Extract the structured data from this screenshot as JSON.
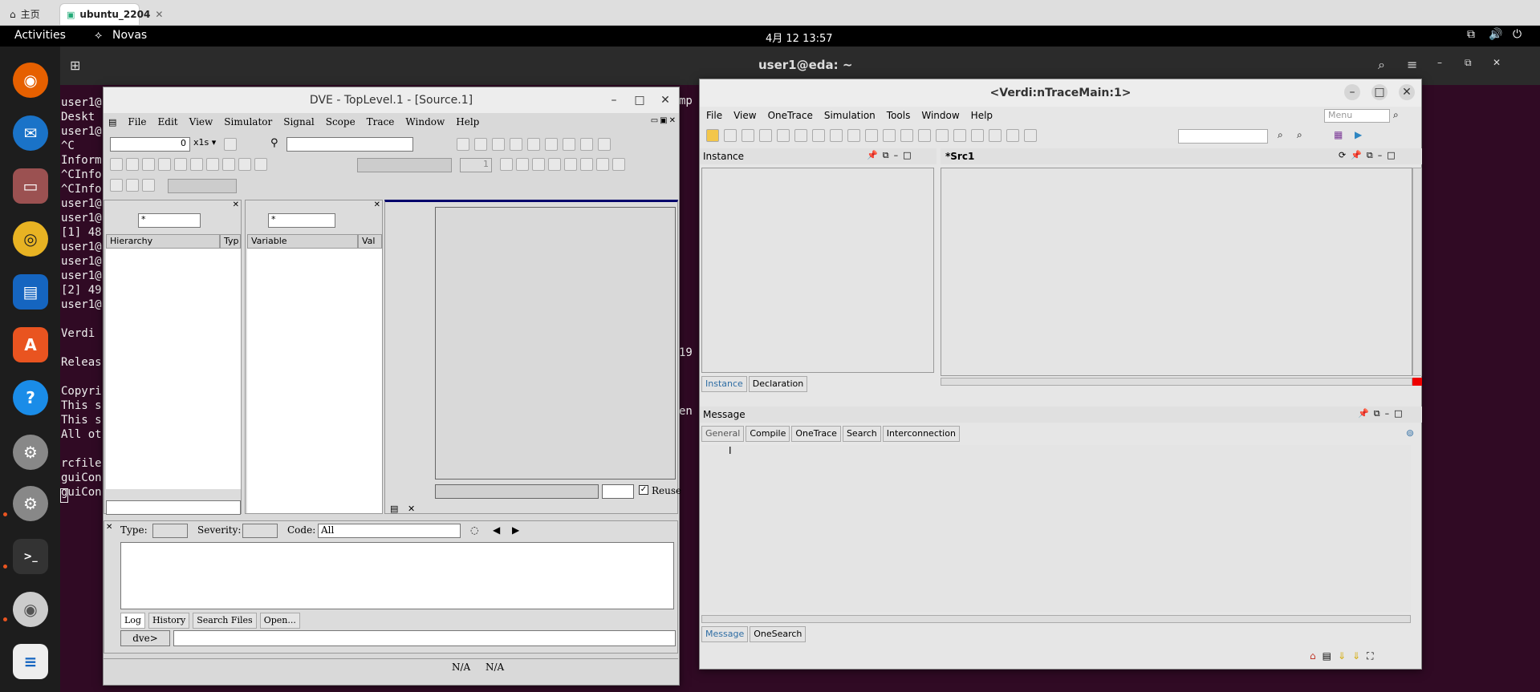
{
  "browser": {
    "tabs": [
      {
        "label": "主页",
        "icon": "home-icon"
      },
      {
        "label": "ubuntu_2204",
        "icon": "vm-icon"
      }
    ]
  },
  "topbar": {
    "activities": "Activities",
    "app_menu": "Novas",
    "clock": "4月 12  13:57"
  },
  "terminal": {
    "title": "user1@eda: ~",
    "lines": [
      "user1@",
      "Deskt",
      "user1@",
      "^C",
      "Inform",
      "^CInfo",
      "^CInfo",
      "user1@",
      "user1@",
      "[1] 48",
      "user1@",
      "user1@",
      "user1@",
      "[2] 49",
      "user1@",
      "",
      "Verdi",
      "",
      "Releas",
      "",
      "Copyri",
      "This s",
      "This s",
      "All ot",
      "",
      "rcfile",
      "guiCon",
      "guiCon"
    ],
    "right_fragments": [
      "mp",
      "19",
      "en"
    ]
  },
  "dve": {
    "title": "DVE - TopLevel.1 - [Source.1]",
    "menu": [
      "File",
      "Edit",
      "View",
      "Simulator",
      "Signal",
      "Scope",
      "Trace",
      "Window",
      "Help"
    ],
    "time_value": "0",
    "time_unit": "x1s",
    "line_value": "1",
    "hier_filter": "*",
    "var_filter": "*",
    "hierarchy_cols": [
      "Hierarchy",
      "Typ"
    ],
    "variable_cols": [
      "Variable",
      "Val"
    ],
    "reuse_label": "Reuse",
    "console": {
      "type_label": "Type:",
      "severity_label": "Severity:",
      "code_label": "Code:",
      "code_value": "All",
      "tabs": [
        "Log",
        "History",
        "Search Files",
        "Open..."
      ],
      "prompt": "dve>"
    },
    "status": [
      "N/A",
      "N/A"
    ]
  },
  "verdi": {
    "title": "<Verdi:nTraceMain:1>",
    "menu": [
      "File",
      "View",
      "OneTrace",
      "Simulation",
      "Tools",
      "Window",
      "Help"
    ],
    "menu_search_placeholder": "Menu",
    "instance_panel": {
      "title": "Instance",
      "tabs": [
        "Instance",
        "Declaration"
      ]
    },
    "src_panel": {
      "title": "*Src1"
    },
    "message_panel": {
      "title": "Message",
      "tabs": [
        "General",
        "Compile",
        "OneTrace",
        "Search",
        "Interconnection"
      ]
    },
    "bottom_tabs": [
      "Message",
      "OneSearch"
    ]
  }
}
